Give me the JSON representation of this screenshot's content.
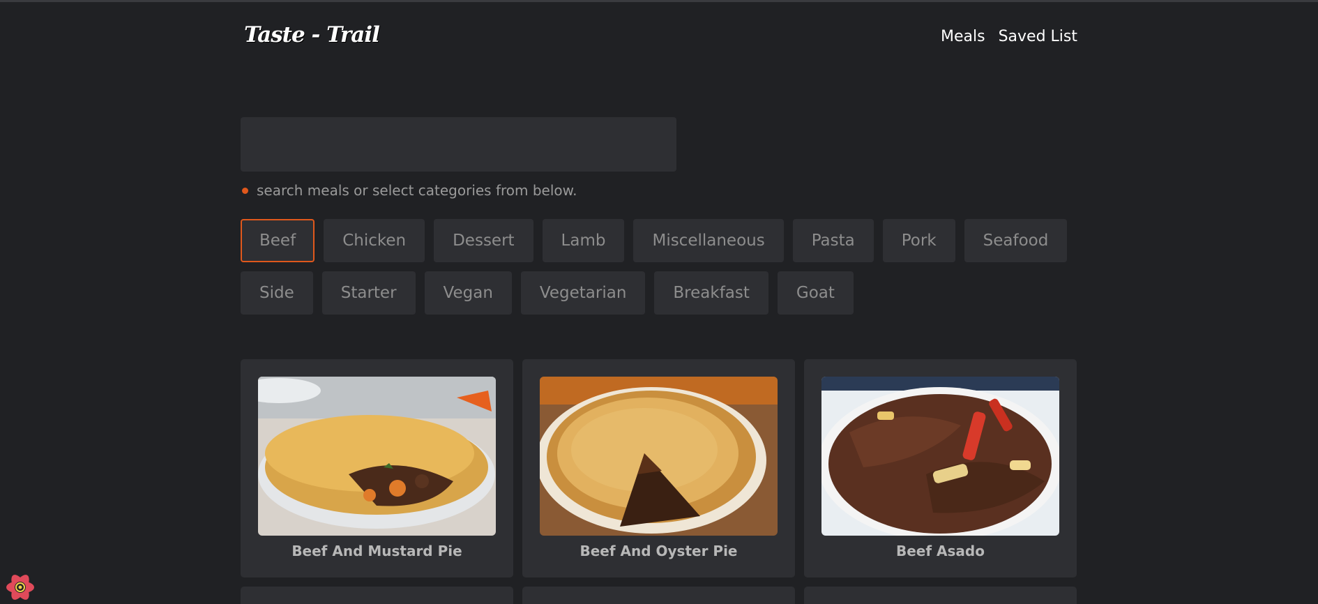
{
  "brand": {
    "logo": "Taste - Trail"
  },
  "nav": {
    "meals": "Meals",
    "saved": "Saved List"
  },
  "search": {
    "placeholder": "",
    "value": "",
    "hint": "search meals or select categories from below."
  },
  "categories": {
    "active": "Beef",
    "items": [
      "Beef",
      "Chicken",
      "Dessert",
      "Lamb",
      "Miscellaneous",
      "Pasta",
      "Pork",
      "Seafood",
      "Side",
      "Starter",
      "Vegan",
      "Vegetarian",
      "Breakfast",
      "Goat"
    ]
  },
  "meals": [
    {
      "name": "Beef And Mustard Pie"
    },
    {
      "name": "Beef And Oyster Pie"
    },
    {
      "name": "Beef Asado"
    }
  ],
  "colors": {
    "accent": "#e0581c",
    "background": "#202124",
    "surface": "#2e2f33"
  }
}
